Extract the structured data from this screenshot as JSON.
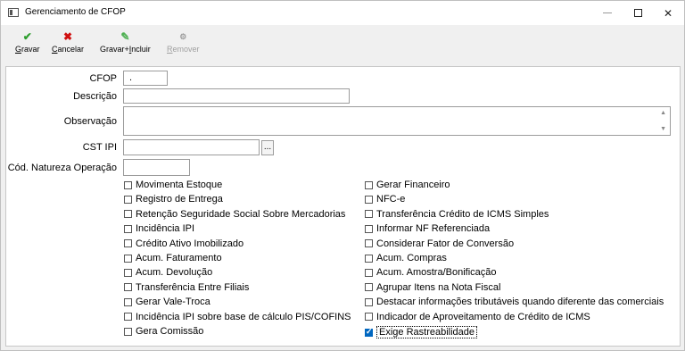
{
  "window": {
    "title": "Gerenciamento de CFOP"
  },
  "titlebar_buttons": {
    "close": "✕"
  },
  "toolbar": {
    "items": [
      {
        "label": "Gravar",
        "icon": "check-icon",
        "color": "#2e9e2e",
        "glyph": "✔"
      },
      {
        "label": "Cancelar",
        "icon": "x-icon",
        "color": "#d01010",
        "glyph": "✖"
      },
      {
        "label": "Gravar+Incluir",
        "icon": "save-add-icon",
        "color": "#4caf50",
        "glyph": "✎"
      },
      {
        "label": "Remover",
        "icon": "remove-icon",
        "color": "#a0a0a0",
        "glyph": "⚙"
      }
    ]
  },
  "form": {
    "cfop_label": "CFOP",
    "cfop_value": ".",
    "descricao_label": "Descrição",
    "descricao_value": "",
    "observacao_label": "Observação",
    "observacao_value": "",
    "cst_ipi_label": "CST IPI",
    "cst_ipi_value": "",
    "ellipsis": "...",
    "natureza_label": "Cód. Natureza Operação",
    "natureza_value": ""
  },
  "checkboxes_left": [
    {
      "label": "Movimenta Estoque",
      "checked": false
    },
    {
      "label": "Registro de Entrega",
      "checked": false
    },
    {
      "label": "Retenção Seguridade Social Sobre Mercadorias",
      "checked": false
    },
    {
      "label": "Incidência IPI",
      "checked": false
    },
    {
      "label": "Crédito Ativo Imobilizado",
      "checked": false
    },
    {
      "label": "Acum. Faturamento",
      "checked": false
    },
    {
      "label": "Acum. Devolução",
      "checked": false
    },
    {
      "label": "Transferência Entre Filiais",
      "checked": false
    },
    {
      "label": "Gerar Vale-Troca",
      "checked": false
    },
    {
      "label": "Incidência IPI sobre base de cálculo PIS/COFINS",
      "checked": false
    },
    {
      "label": "Gera Comissão",
      "checked": false
    }
  ],
  "checkboxes_right": [
    {
      "label": "Gerar Financeiro",
      "checked": false
    },
    {
      "label": "NFC-e",
      "checked": false
    },
    {
      "label": "Transferência Crédito de ICMS Simples",
      "checked": false
    },
    {
      "label": "Informar NF Referenciada",
      "checked": false
    },
    {
      "label": "Considerar Fator de Conversão",
      "checked": false
    },
    {
      "label": "Acum. Compras",
      "checked": false
    },
    {
      "label": "Acum. Amostra/Bonificação",
      "checked": false
    },
    {
      "label": "Agrupar Itens na Nota Fiscal",
      "checked": false
    },
    {
      "label": "Destacar informações tributáveis quando diferente das comerciais",
      "checked": false
    },
    {
      "label": "Indicador de Aproveitamento de Crédito de ICMS",
      "checked": false
    },
    {
      "label": "Exige Rastreabilidade",
      "checked": true
    }
  ]
}
